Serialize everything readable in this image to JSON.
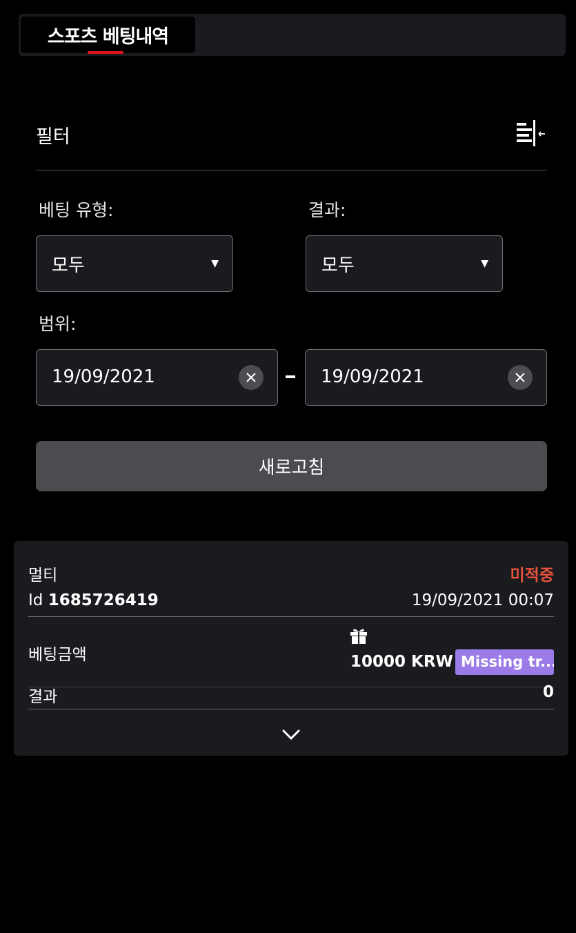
{
  "header": {
    "tab_label": "스포츠 베팅내역"
  },
  "filter": {
    "title": "필터",
    "bet_type_label": "베팅 유형:",
    "bet_type_value": "모두",
    "result_label": "결과:",
    "result_value": "모두",
    "range_label": "범위:",
    "date_from": "19/09/2021",
    "date_to": "19/09/2021",
    "refresh_label": "새로고침"
  },
  "bet": {
    "type": "멀티",
    "status": "미적중",
    "status_color": "#e8513c",
    "id_prefix": "Id",
    "id": "1685726419",
    "datetime": "19/09/2021 00:07",
    "stake_label": "베팅금액",
    "stake": "10000 KRW",
    "badge": "Missing tr...",
    "result_label": "결과",
    "result_value": "0"
  }
}
